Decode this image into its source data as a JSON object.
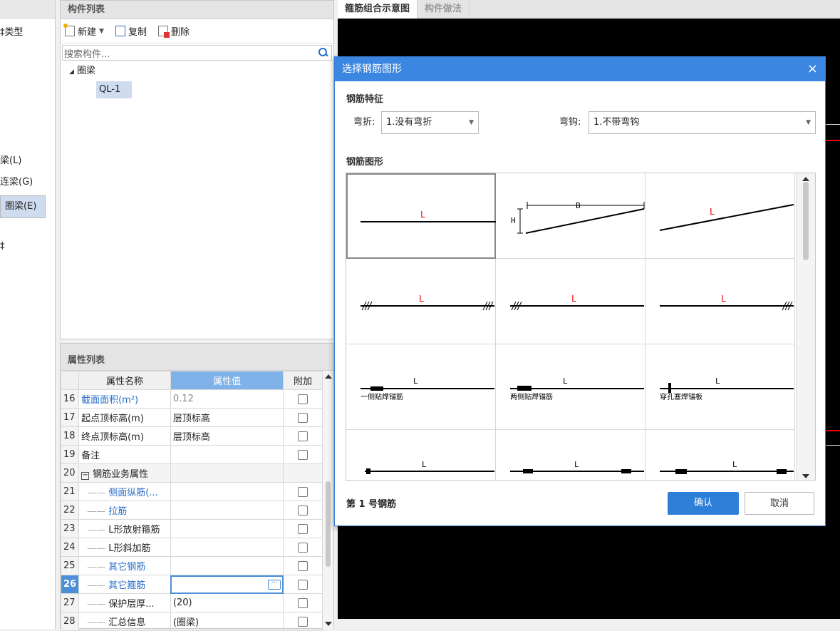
{
  "type_panel": {
    "header": "",
    "items": [
      {
        "label": "‡类型"
      },
      {
        "label": "梁(L)"
      },
      {
        "label": "连梁(G)"
      },
      {
        "label": "圈梁(E)",
        "selected": true
      },
      {
        "label": "‡"
      }
    ]
  },
  "component_list": {
    "title": "构件列表",
    "toolbar": {
      "new": "新建",
      "copy": "复制",
      "delete": "删除"
    },
    "search_placeholder": "搜索构件...",
    "tree": {
      "group": "圈梁",
      "item": "QL-1"
    }
  },
  "property_list": {
    "title": "属性列表",
    "columns": [
      "属性名称",
      "属性值",
      "附加"
    ],
    "rows": [
      {
        "num": "16",
        "name": "截面面积(m²)",
        "value": "0.12",
        "blue": true
      },
      {
        "num": "17",
        "name": "起点顶标高(m)",
        "value": "层顶标高"
      },
      {
        "num": "18",
        "name": "终点顶标高(m)",
        "value": "层顶标高"
      },
      {
        "num": "19",
        "name": "备注",
        "value": ""
      },
      {
        "num": "20",
        "name": "钢筋业务属性",
        "value": "",
        "group": true
      },
      {
        "num": "21",
        "name": "侧面纵筋(...",
        "value": "",
        "blue": true
      },
      {
        "num": "22",
        "name": "拉筋",
        "value": "",
        "blue": true
      },
      {
        "num": "23",
        "name": "L形放射箍筋",
        "value": ""
      },
      {
        "num": "24",
        "name": "L形斜加筋",
        "value": ""
      },
      {
        "num": "25",
        "name": "其它钢筋",
        "value": "",
        "blue": true
      },
      {
        "num": "26",
        "name": "其它箍筋",
        "value": "",
        "blue": true,
        "current": true
      },
      {
        "num": "27",
        "name": "保护层厚...",
        "value": "(20)"
      },
      {
        "num": "28",
        "name": "汇总信息",
        "value": "(圈梁)"
      }
    ]
  },
  "viewer": {
    "tabs": [
      "箍筋组合示意图",
      "构件做法"
    ]
  },
  "dialog": {
    "title": "选择钢筋图形",
    "close": "×",
    "feature_section": "钢筋特征",
    "bend_label": "弯折:",
    "bend_value": "1.没有弯折",
    "hook_label": "弯钩:",
    "hook_value": "1.不带弯钩",
    "shape_section": "钢筋图形",
    "status": "第 1 号钢筋",
    "ok": "确认",
    "cancel": "取消",
    "shapes": [
      {
        "label": "L"
      },
      {
        "label_b": "B",
        "label_h": "H"
      },
      {
        "label": "L"
      },
      {
        "label": "L"
      },
      {
        "label": "L"
      },
      {
        "label": "L"
      },
      {
        "label": "L",
        "caption": "一侧贴焊锚筋"
      },
      {
        "label": "L",
        "caption": "两侧贴焊锚筋"
      },
      {
        "label": "L",
        "caption": "穿孔塞焊锚板"
      },
      {
        "label": "L"
      },
      {
        "label": "L"
      },
      {
        "label": "L"
      }
    ]
  }
}
